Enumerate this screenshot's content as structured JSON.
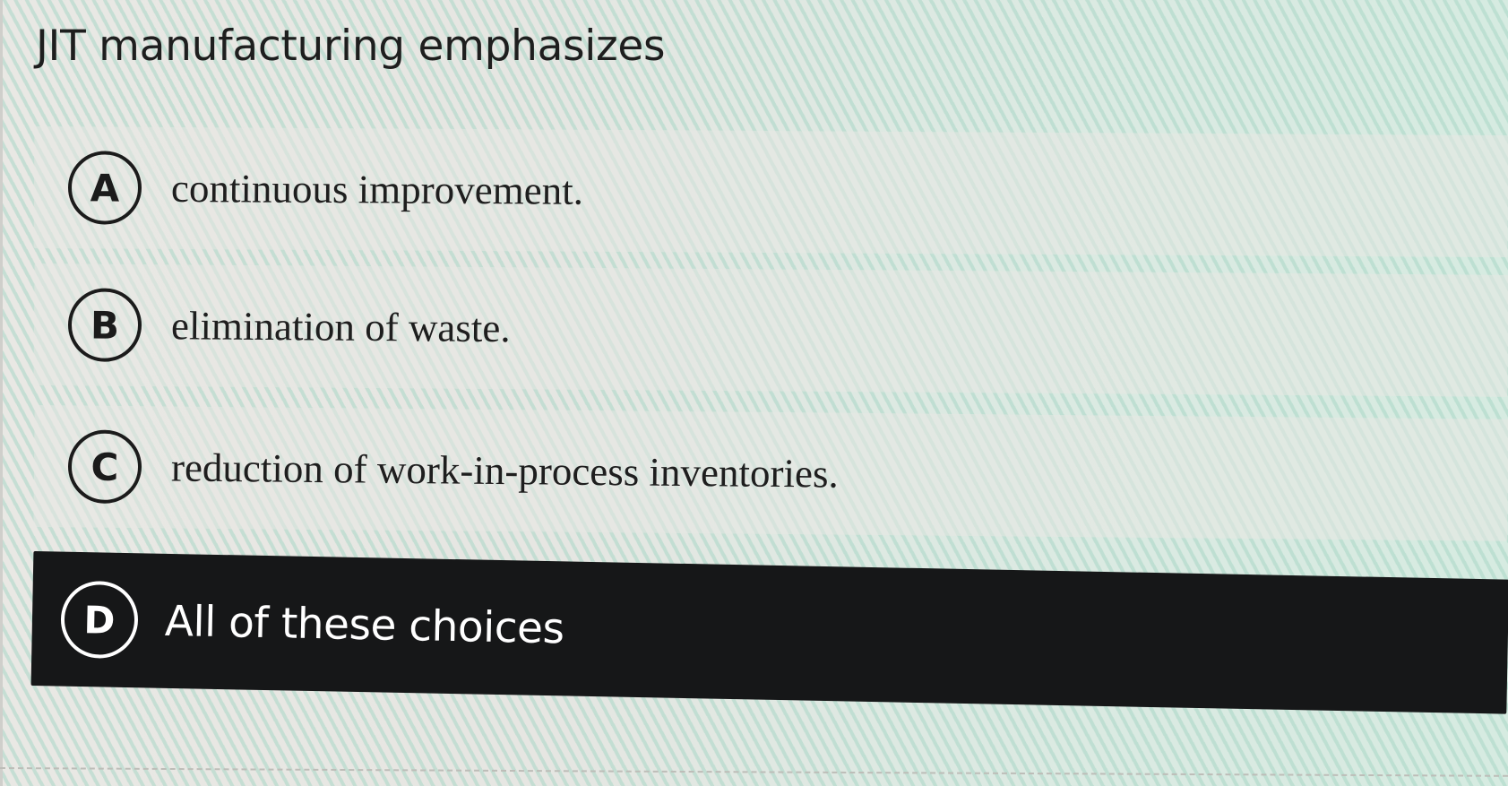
{
  "question": {
    "text": "JIT manufacturing emphasizes"
  },
  "options": [
    {
      "letter": "A",
      "text": "continuous improvement.",
      "selected": false
    },
    {
      "letter": "B",
      "text": "elimination of waste.",
      "selected": false
    },
    {
      "letter": "C",
      "text": "reduction of work-in-process inventories.",
      "selected": false
    },
    {
      "letter": "D",
      "text": "All of these choices",
      "selected": true
    }
  ],
  "colors": {
    "selected_background": "#161718",
    "selected_text": "#ffffff",
    "text": "#1e1e1e"
  }
}
